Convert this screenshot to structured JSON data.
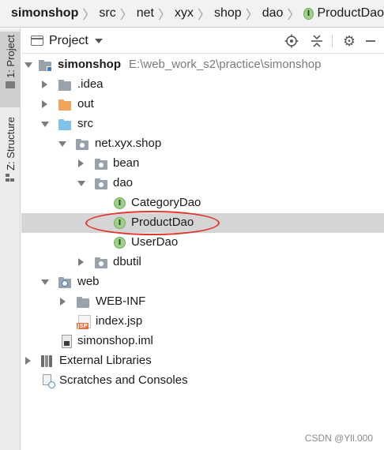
{
  "breadcrumb": {
    "items": [
      "simonshop",
      "src",
      "net",
      "xyx",
      "shop",
      "dao",
      "ProductDao"
    ],
    "separator": "〉",
    "leaf_badge": "I"
  },
  "toolstrip": {
    "project_tab": "1: Project",
    "structure_tab": "Z: Structure"
  },
  "project_panel": {
    "title": "Project",
    "locate_icon": "crosshair-icon",
    "collapse_icon": "collapse-all-icon",
    "settings_icon": "gear-icon",
    "hide_icon": "minimize-icon"
  },
  "tree": [
    {
      "label": "simonshop",
      "path": "E:\\web_work_s2\\practice\\simonshop",
      "icon": "module-folder-icon",
      "expanded": true
    },
    {
      "label": ".idea",
      "icon": "folder-icon",
      "expanded": false
    },
    {
      "label": "out",
      "icon": "excluded-folder-icon",
      "expanded": false
    },
    {
      "label": "src",
      "icon": "source-folder-icon",
      "expanded": true
    },
    {
      "label": "net.xyx.shop",
      "icon": "package-icon",
      "expanded": true
    },
    {
      "label": "bean",
      "icon": "package-icon",
      "expanded": false
    },
    {
      "label": "dao",
      "icon": "package-icon",
      "expanded": true
    },
    {
      "label": "CategoryDao",
      "icon": "interface-icon",
      "badge": "I"
    },
    {
      "label": "ProductDao",
      "icon": "interface-icon",
      "badge": "I",
      "selected": true
    },
    {
      "label": "UserDao",
      "icon": "interface-icon",
      "badge": "I"
    },
    {
      "label": "dbutil",
      "icon": "package-icon",
      "expanded": false
    },
    {
      "label": "web",
      "icon": "web-folder-icon",
      "expanded": true
    },
    {
      "label": "WEB-INF",
      "icon": "folder-icon",
      "expanded": false
    },
    {
      "label": "index.jsp",
      "icon": "jsp-file-icon",
      "badge": "JSP"
    },
    {
      "label": "simonshop.iml",
      "icon": "iml-file-icon"
    },
    {
      "label": "External Libraries",
      "icon": "libraries-icon",
      "expanded": false
    },
    {
      "label": "Scratches and Consoles",
      "icon": "scratches-icon"
    }
  ],
  "colors": {
    "selection": "#d5d5d5",
    "highlight_ellipse": "#e0362e",
    "interface_badge": "#9fcf8a",
    "source_folder": "#7fc2ea",
    "excluded_folder": "#f0a55a"
  },
  "watermark": "CSDN @Yll.000"
}
